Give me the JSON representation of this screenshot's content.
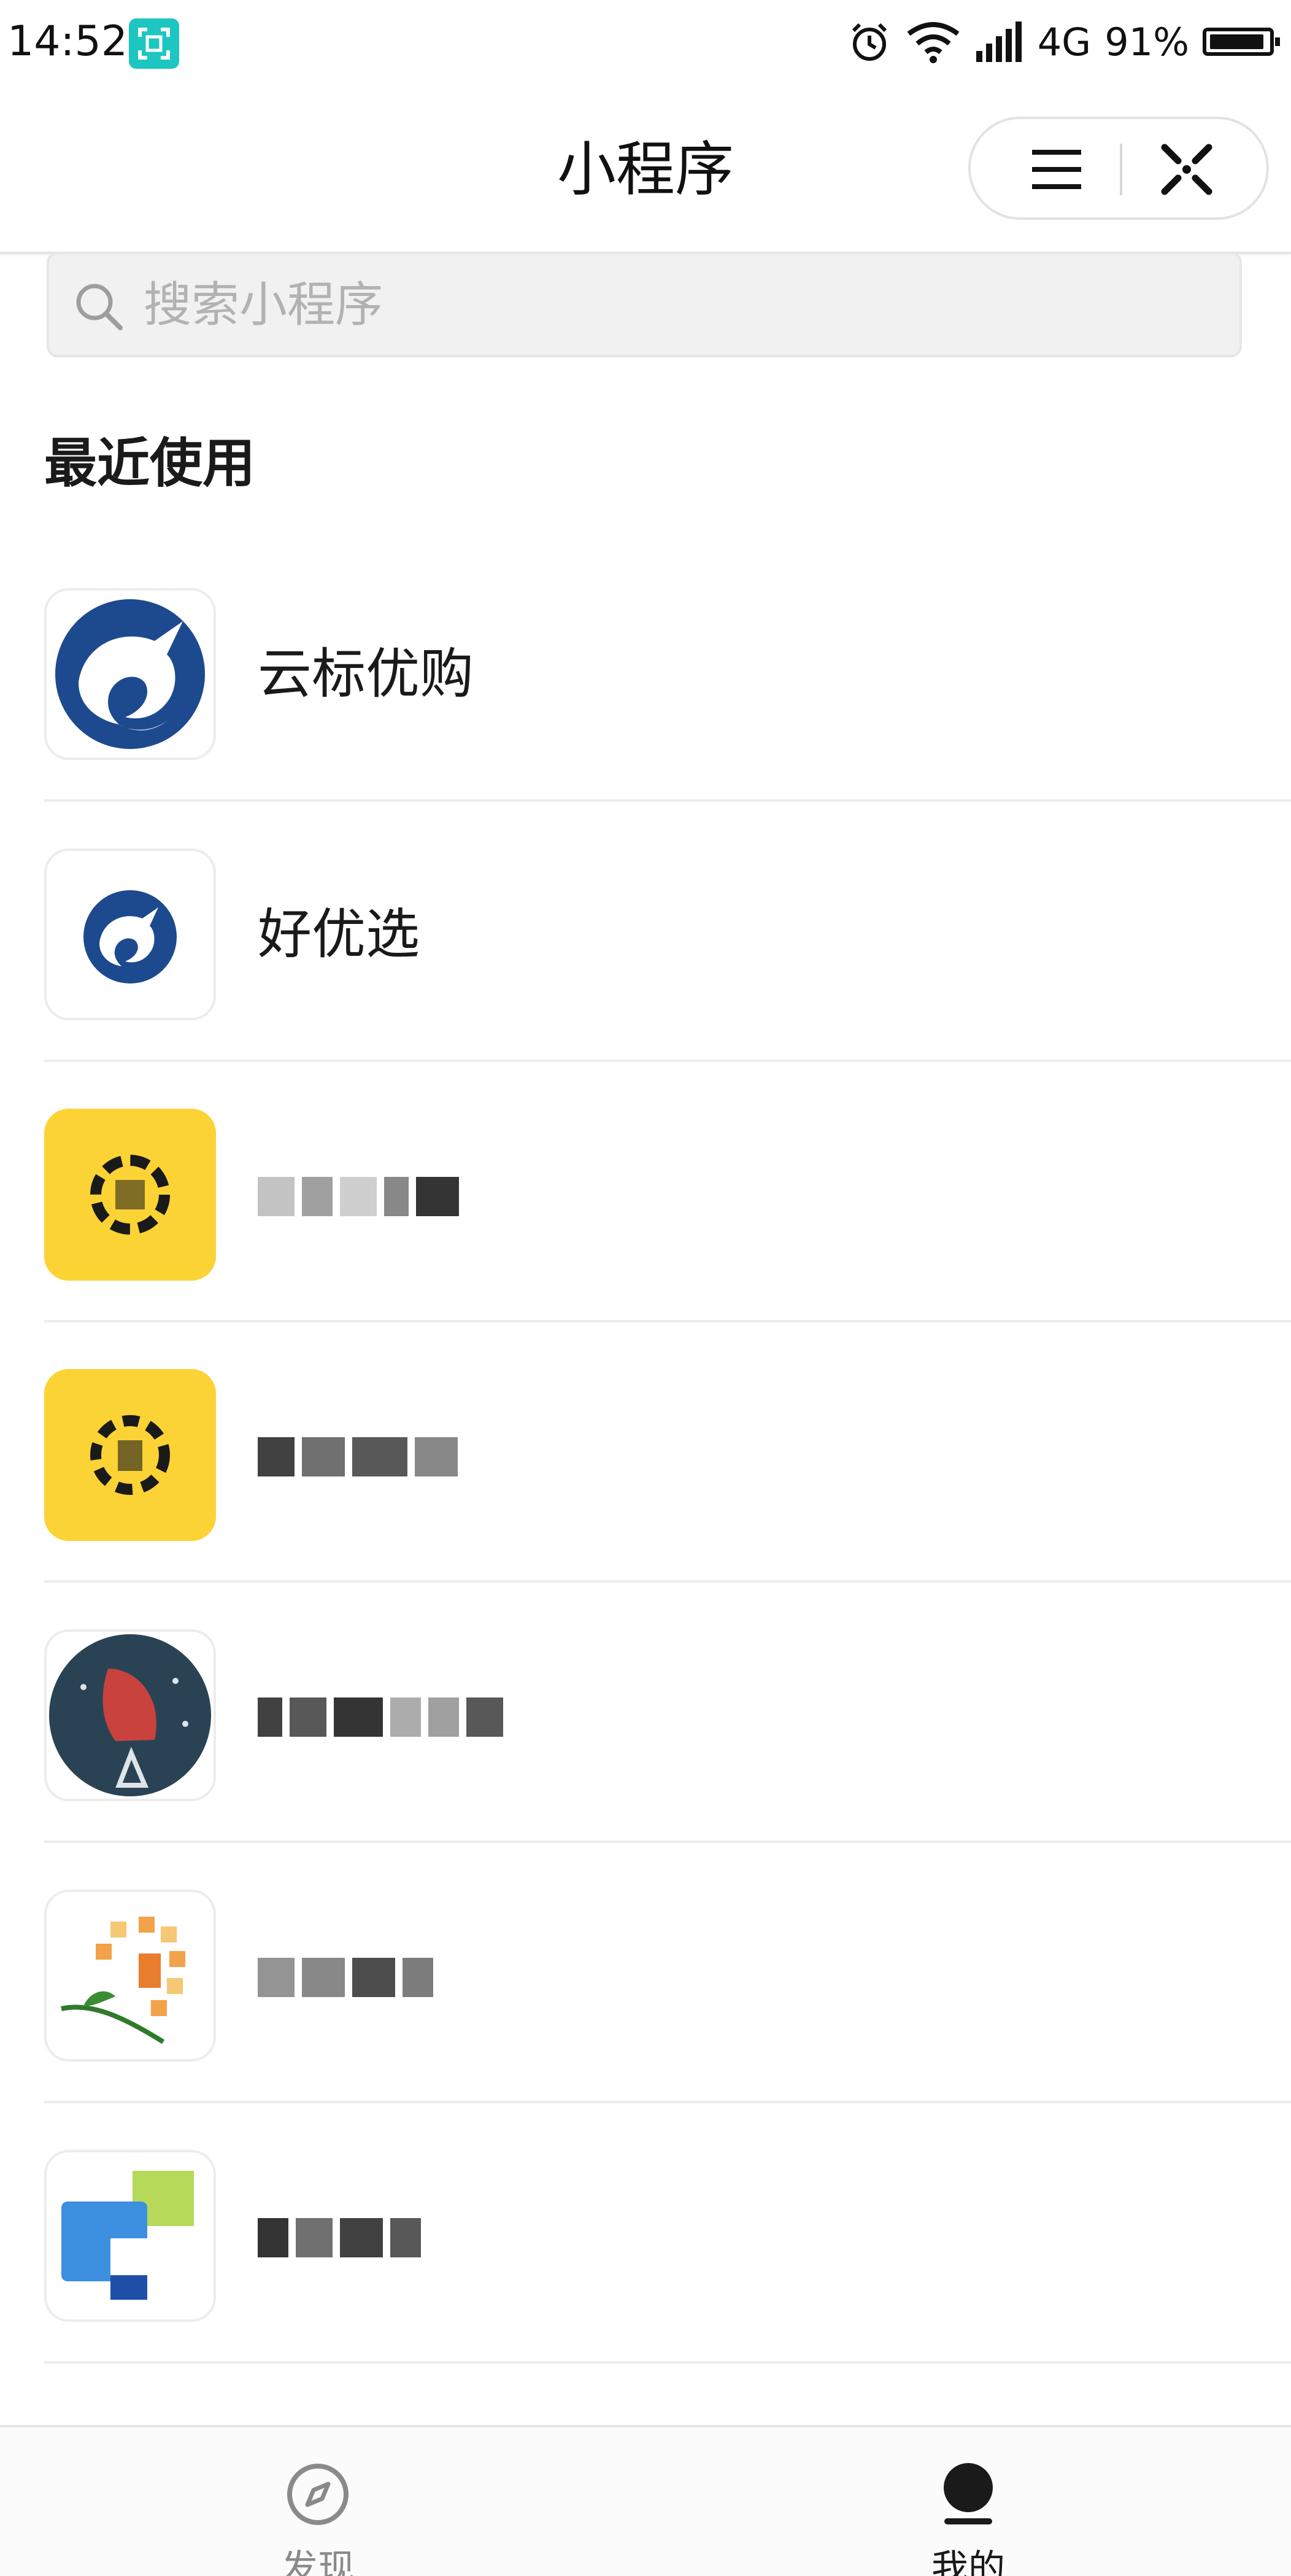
{
  "status_bar": {
    "time": "14:52",
    "network": "4G",
    "battery": "91%",
    "icons": [
      "scan-app-icon",
      "alarm-icon",
      "wifi-icon",
      "signal-icon",
      "battery-icon"
    ]
  },
  "header": {
    "title": "小程序",
    "menu_icon": "menu-icon",
    "close_icon": "close-icon"
  },
  "search": {
    "placeholder": "搜索小程序"
  },
  "recent": {
    "title": "最近使用",
    "items": [
      {
        "label": "云标优购",
        "icon": "unicorn-logo"
      },
      {
        "label": "好优选",
        "icon": "unicorn-logo"
      },
      {
        "label": "",
        "icon": "yellow-logo",
        "redacted": true
      },
      {
        "label": "",
        "icon": "yellow-logo",
        "redacted": true
      },
      {
        "label": "",
        "icon": "red-flower-logo",
        "redacted": true
      },
      {
        "label": "",
        "icon": "sunflower-logo",
        "redacted": true
      },
      {
        "label": "",
        "icon": "blue-green-logo",
        "redacted": true
      }
    ]
  },
  "tab_bar": {
    "tabs": [
      {
        "label": "发现",
        "icon": "compass-icon",
        "active": false
      },
      {
        "label": "我的",
        "icon": "profile-icon",
        "active": true
      }
    ]
  },
  "colors": {
    "accent_blue": "#1d4a8f",
    "yellow": "#fbd335",
    "teal": "#1dc6c0"
  }
}
